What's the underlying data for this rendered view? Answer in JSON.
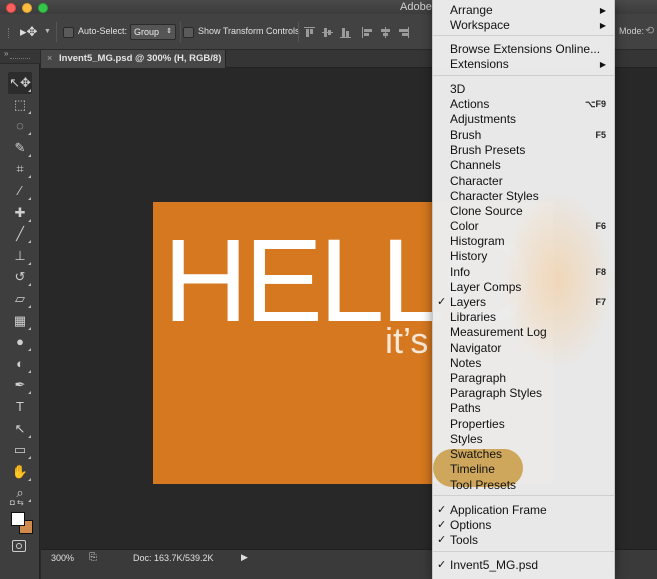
{
  "window": {
    "title": "Adobe"
  },
  "options_bar": {
    "auto_select_label": "Auto-Select:",
    "auto_select_value": "Group",
    "show_transform_label": "Show Transform Controls",
    "mode_label": "Mode:"
  },
  "document": {
    "tab_title": "Invent5_MG.psd @ 300% (H, RGB/8)",
    "artwork_title": "HELLO",
    "artwork_subtitle": "it’s"
  },
  "status_bar": {
    "zoom": "300%",
    "doc_size": "Doc: 163.7K/539.2K"
  },
  "colors": {
    "foreground": "#ffffff",
    "background": "#d08a4b",
    "artwork": "#d6781f",
    "highlight": "#c69434"
  },
  "tools": [
    {
      "name": "move-tool-icon",
      "glyph": "↖✥"
    },
    {
      "name": "marquee-tool-icon",
      "glyph": "⬚"
    },
    {
      "name": "lasso-tool-icon",
      "glyph": "◌"
    },
    {
      "name": "quick-selection-tool-icon",
      "glyph": "✎"
    },
    {
      "name": "crop-tool-icon",
      "glyph": "⌗"
    },
    {
      "name": "eyedropper-tool-icon",
      "glyph": "⁄"
    },
    {
      "name": "healing-brush-tool-icon",
      "glyph": "✚"
    },
    {
      "name": "brush-tool-icon",
      "glyph": "╱"
    },
    {
      "name": "clone-stamp-tool-icon",
      "glyph": "⊥"
    },
    {
      "name": "history-brush-tool-icon",
      "glyph": "↺"
    },
    {
      "name": "eraser-tool-icon",
      "glyph": "▱"
    },
    {
      "name": "gradient-tool-icon",
      "glyph": "▦"
    },
    {
      "name": "blur-tool-icon",
      "glyph": "●"
    },
    {
      "name": "dodge-tool-icon",
      "glyph": "◐"
    },
    {
      "name": "pen-tool-icon",
      "glyph": "✒"
    },
    {
      "name": "type-tool-icon",
      "glyph": "T"
    },
    {
      "name": "path-selection-tool-icon",
      "glyph": "↖"
    },
    {
      "name": "shape-tool-icon",
      "glyph": "▭"
    },
    {
      "name": "hand-tool-icon",
      "glyph": "✋"
    },
    {
      "name": "zoom-tool-icon",
      "glyph": "⌕"
    }
  ],
  "menu": {
    "items": [
      {
        "label": "Arrange",
        "submenu": true
      },
      {
        "label": "Workspace",
        "submenu": true
      },
      {
        "label": "Browse Extensions Online..."
      },
      {
        "label": "Extensions",
        "submenu": true
      },
      {
        "label": "3D"
      },
      {
        "label": "Actions",
        "shortcut": "⌥F9"
      },
      {
        "label": "Adjustments"
      },
      {
        "label": "Brush",
        "shortcut": "F5"
      },
      {
        "label": "Brush Presets"
      },
      {
        "label": "Channels"
      },
      {
        "label": "Character"
      },
      {
        "label": "Character Styles"
      },
      {
        "label": "Clone Source"
      },
      {
        "label": "Color",
        "shortcut": "F6"
      },
      {
        "label": "Histogram"
      },
      {
        "label": "History"
      },
      {
        "label": "Info",
        "shortcut": "F8"
      },
      {
        "label": "Layer Comps"
      },
      {
        "label": "Layers",
        "shortcut": "F7",
        "checked": true
      },
      {
        "label": "Libraries"
      },
      {
        "label": "Measurement Log"
      },
      {
        "label": "Navigator"
      },
      {
        "label": "Notes"
      },
      {
        "label": "Paragraph"
      },
      {
        "label": "Paragraph Styles"
      },
      {
        "label": "Paths"
      },
      {
        "label": "Properties"
      },
      {
        "label": "Styles"
      },
      {
        "label": "Swatches"
      },
      {
        "label": "Timeline"
      },
      {
        "label": "Tool Presets"
      },
      {
        "label": "Application Frame",
        "checked": true
      },
      {
        "label": "Options",
        "checked": true
      },
      {
        "label": "Tools",
        "checked": true
      },
      {
        "label": "Invent5_MG.psd",
        "checked": true
      }
    ]
  }
}
